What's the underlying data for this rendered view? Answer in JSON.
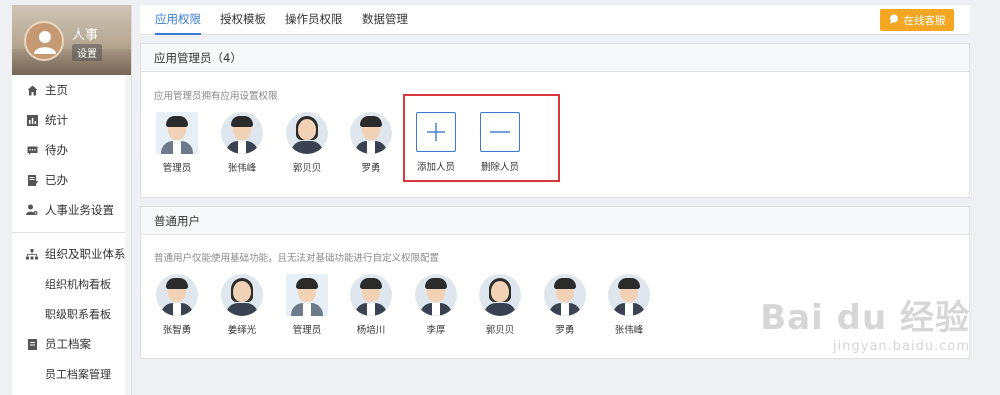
{
  "sidebar": {
    "user_name": "人事",
    "settings_label": "设置",
    "items": [
      {
        "label": "主页",
        "icon": "home-icon"
      },
      {
        "label": "统计",
        "icon": "bar-chart-icon"
      },
      {
        "label": "待办",
        "icon": "chat-icon"
      },
      {
        "label": "已办",
        "icon": "document-check-icon"
      },
      {
        "label": "人事业务设置",
        "icon": "user-gear-icon"
      }
    ],
    "group1": {
      "label": "组织及职业体系",
      "icon": "org-chart-icon",
      "subs": [
        "组织机构看板",
        "职级职系看板"
      ]
    },
    "group2": {
      "label": "员工档案",
      "icon": "file-icon",
      "subs": [
        "员工档案管理"
      ]
    }
  },
  "tabs": [
    "应用权限",
    "授权模板",
    "操作员权限",
    "数据管理"
  ],
  "active_tab": "应用权限",
  "service_button": "在线客服",
  "admin_panel": {
    "title": "应用管理员（4）",
    "description": "应用管理员拥有应用设置权限",
    "members": [
      "管理员",
      "张伟峰",
      "郭贝贝",
      "罗勇"
    ],
    "add_label": "添加人员",
    "remove_label": "删除人员"
  },
  "user_panel": {
    "title": "普通用户",
    "description": "普通用户仅能使用基础功能，且无法对基础功能进行自定义权限配置",
    "members": [
      "张智勇",
      "姜绎光",
      "管理员",
      "杨培川",
      "李厚",
      "郭贝贝",
      "罗勇",
      "张伟峰"
    ]
  },
  "watermark": {
    "main": "Bai du 经验",
    "url": "jingyan.baidu.com"
  },
  "colors": {
    "accent": "#3b7bd6",
    "service": "#f5a623",
    "highlight": "#d9363e"
  }
}
